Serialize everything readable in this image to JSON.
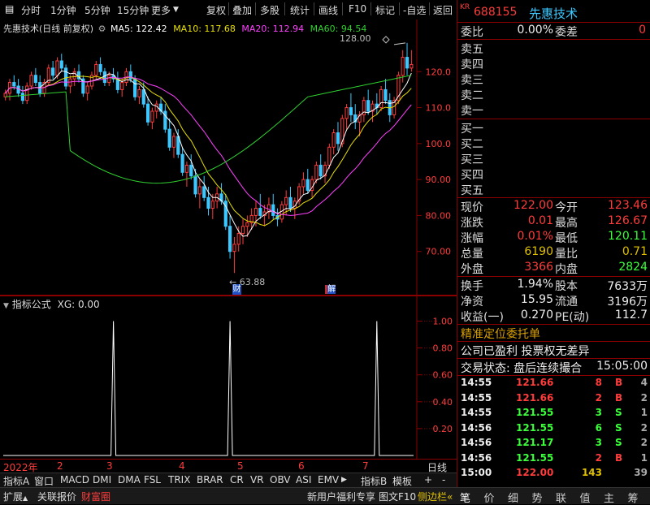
{
  "toolbar": {
    "left_items": [
      "分时",
      "1分钟",
      "5分钟",
      "15分钟",
      "更多"
    ],
    "right_items": [
      "复权",
      "叠加",
      "多股",
      "统计",
      "画线",
      "F10",
      "标记",
      "-自选",
      "返回"
    ]
  },
  "chart_header": {
    "title": "先惠技术(日线 前复权)",
    "ma5": "MA5: 122.42",
    "ma10": "MA10: 117.68",
    "ma20": "MA20: 112.94",
    "ma60": "MA60: 94.54"
  },
  "chart_annotations": {
    "high_label": "128.00",
    "low_label": "63.88",
    "marker_cai": "财",
    "marker_jie": "解"
  },
  "indicator_header": {
    "title": "指标公式",
    "value": "XG: 0.00"
  },
  "time_axis": {
    "year": "2022年",
    "months": [
      "2",
      "3",
      "4",
      "5",
      "6",
      "7"
    ],
    "right_label": "日线"
  },
  "chart_data": [
    {
      "type": "candlestick",
      "title": "先惠技术(日线 前复权)",
      "ylim": [
        60,
        130
      ],
      "y_ticks": [
        "120.0",
        "110.0",
        "100.0",
        "90.00",
        "80.00",
        "70.00"
      ],
      "y_tick_values": [
        120,
        110,
        100,
        90,
        80,
        70
      ],
      "series": [
        {
          "name": "MA5",
          "color": "#ffffff"
        },
        {
          "name": "MA10",
          "color": "#e8e000"
        },
        {
          "name": "MA20",
          "color": "#ff40ff"
        },
        {
          "name": "MA60",
          "color": "#30d030"
        }
      ],
      "candles": [
        [
          113,
          115,
          112,
          114
        ],
        [
          114,
          118,
          112,
          117
        ],
        [
          117,
          119,
          115,
          116
        ],
        [
          116,
          118,
          113,
          114
        ],
        [
          114,
          116,
          111,
          112
        ],
        [
          112,
          117,
          111,
          116
        ],
        [
          116,
          120,
          115,
          119
        ],
        [
          119,
          121,
          116,
          117
        ],
        [
          117,
          119,
          113,
          114
        ],
        [
          114,
          118,
          113,
          117
        ],
        [
          117,
          122,
          116,
          121
        ],
        [
          121,
          123,
          118,
          119
        ],
        [
          119,
          124,
          118,
          123
        ],
        [
          123,
          125,
          120,
          121
        ],
        [
          121,
          122,
          115,
          116
        ],
        [
          116,
          119,
          114,
          118
        ],
        [
          118,
          121,
          116,
          120
        ],
        [
          120,
          122,
          117,
          118
        ],
        [
          118,
          119,
          113,
          114
        ],
        [
          114,
          117,
          112,
          116
        ],
        [
          116,
          120,
          115,
          119
        ],
        [
          119,
          123,
          118,
          122
        ],
        [
          122,
          124,
          119,
          120
        ],
        [
          120,
          121,
          116,
          117
        ],
        [
          117,
          120,
          116,
          119
        ],
        [
          119,
          121,
          117,
          118
        ],
        [
          118,
          120,
          114,
          115
        ],
        [
          115,
          118,
          113,
          117
        ],
        [
          117,
          121,
          116,
          120
        ],
        [
          120,
          122,
          117,
          118
        ],
        [
          118,
          119,
          112,
          113
        ],
        [
          113,
          116,
          111,
          115
        ],
        [
          115,
          117,
          110,
          111
        ],
        [
          111,
          113,
          105,
          106
        ],
        [
          106,
          110,
          104,
          109
        ],
        [
          109,
          112,
          107,
          111
        ],
        [
          111,
          113,
          108,
          109
        ],
        [
          109,
          111,
          103,
          104
        ],
        [
          104,
          107,
          98,
          99
        ],
        [
          99,
          103,
          96,
          102
        ],
        [
          102,
          104,
          96,
          97
        ],
        [
          97,
          99,
          91,
          92
        ],
        [
          92,
          95,
          88,
          94
        ],
        [
          94,
          97,
          90,
          91
        ],
        [
          91,
          93,
          85,
          86
        ],
        [
          86,
          90,
          82,
          88
        ],
        [
          88,
          91,
          84,
          85
        ],
        [
          85,
          88,
          80,
          82
        ],
        [
          82,
          86,
          79,
          84
        ],
        [
          84,
          88,
          82,
          86
        ],
        [
          86,
          89,
          83,
          84
        ],
        [
          84,
          86,
          76,
          77
        ],
        [
          77,
          80,
          68,
          70
        ],
        [
          70,
          74,
          64,
          72
        ],
        [
          72,
          77,
          70,
          75
        ],
        [
          75,
          79,
          72,
          77
        ],
        [
          77,
          80,
          74,
          78
        ],
        [
          78,
          82,
          76,
          80
        ],
        [
          80,
          84,
          77,
          82
        ],
        [
          82,
          86,
          79,
          80
        ],
        [
          80,
          83,
          77,
          81
        ],
        [
          81,
          85,
          79,
          83
        ],
        [
          83,
          86,
          79,
          80
        ],
        [
          80,
          82,
          77,
          79
        ],
        [
          79,
          84,
          78,
          83
        ],
        [
          83,
          87,
          80,
          85
        ],
        [
          85,
          88,
          81,
          82
        ],
        [
          82,
          85,
          79,
          84
        ],
        [
          84,
          89,
          83,
          88
        ],
        [
          88,
          92,
          86,
          90
        ],
        [
          90,
          93,
          86,
          87
        ],
        [
          87,
          91,
          85,
          90
        ],
        [
          90,
          95,
          89,
          94
        ],
        [
          94,
          97,
          90,
          91
        ],
        [
          91,
          95,
          89,
          94
        ],
        [
          94,
          100,
          93,
          99
        ],
        [
          99,
          104,
          97,
          103
        ],
        [
          103,
          106,
          98,
          100
        ],
        [
          100,
          108,
          99,
          107
        ],
        [
          107,
          111,
          104,
          110
        ],
        [
          110,
          114,
          106,
          108
        ],
        [
          108,
          111,
          104,
          106
        ],
        [
          106,
          109,
          102,
          108
        ],
        [
          108,
          113,
          106,
          112
        ],
        [
          112,
          115,
          108,
          109
        ],
        [
          109,
          112,
          106,
          111
        ],
        [
          111,
          114,
          108,
          110
        ],
        [
          110,
          116,
          109,
          115
        ],
        [
          115,
          118,
          111,
          112
        ],
        [
          112,
          114,
          106,
          108
        ],
        [
          108,
          113,
          107,
          112
        ],
        [
          112,
          120,
          111,
          119
        ],
        [
          119,
          126,
          117,
          124
        ],
        [
          124,
          128,
          119,
          121
        ],
        [
          121,
          126,
          120,
          122
        ]
      ]
    },
    {
      "type": "line",
      "title": "指标公式",
      "ylim": [
        0,
        1.1
      ],
      "y_ticks": [
        "1.00",
        "0.80",
        "0.60",
        "0.40",
        "0.20"
      ],
      "y_tick_values": [
        1.0,
        0.8,
        0.6,
        0.4,
        0.2
      ],
      "series": [
        {
          "name": "XG",
          "color": "#ffffff",
          "spikes_at_candle": [
            25,
            52,
            86
          ]
        }
      ]
    }
  ],
  "quote": {
    "prefix": "KR",
    "code": "688155",
    "name": "先惠技术",
    "webi_label": "委比",
    "webi_value": "0.00%",
    "weicha_label": "委差",
    "weicha_value": "0",
    "sell_labels": [
      "卖五",
      "卖四",
      "卖三",
      "卖二",
      "卖一"
    ],
    "buy_labels": [
      "买一",
      "买二",
      "买三",
      "买四",
      "买五"
    ],
    "stats": [
      {
        "l1": "现价",
        "v1": "122.00",
        "c1": "red",
        "l2": "今开",
        "v2": "123.46",
        "c2": "red"
      },
      {
        "l1": "涨跌",
        "v1": "0.01",
        "c1": "red",
        "l2": "最高",
        "v2": "126.67",
        "c2": "red"
      },
      {
        "l1": "涨幅",
        "v1": "0.01%",
        "c1": "red",
        "l2": "最低",
        "v2": "120.11",
        "c2": "green"
      },
      {
        "l1": "总量",
        "v1": "6190",
        "c1": "yellow",
        "l2": "量比",
        "v2": "0.71",
        "c2": "yellow"
      },
      {
        "l1": "外盘",
        "v1": "3366",
        "c1": "red",
        "l2": "内盘",
        "v2": "2824",
        "c2": "green"
      }
    ],
    "stats2": [
      {
        "l1": "换手",
        "v1": "1.94%",
        "l2": "股本",
        "v2": "7633万"
      },
      {
        "l1": "净资",
        "v1": "15.95",
        "l2": "流通",
        "v2": "3196万"
      },
      {
        "l1": "收益(一)",
        "v1": "0.270",
        "l2": "PE(动)",
        "v2": "112.7"
      }
    ],
    "promo": "精准定位委托单",
    "notice": "公司已盈利 投票权无差异",
    "trade_status_label": "交易状态: 盘后连续撮合",
    "trade_status_time": "15:05:00",
    "ticks": [
      {
        "time": "14:55",
        "price": "121.66",
        "vol": "8",
        "dir": "B",
        "n": "4"
      },
      {
        "time": "14:55",
        "price": "121.66",
        "vol": "2",
        "dir": "B",
        "n": "2"
      },
      {
        "time": "14:55",
        "price": "121.55",
        "vol": "3",
        "dir": "S",
        "n": "1"
      },
      {
        "time": "14:56",
        "price": "121.55",
        "vol": "6",
        "dir": "S",
        "n": "2"
      },
      {
        "time": "14:56",
        "price": "121.17",
        "vol": "3",
        "dir": "S",
        "n": "2"
      },
      {
        "time": "14:56",
        "price": "121.55",
        "vol": "2",
        "dir": "B",
        "n": "1"
      },
      {
        "time": "15:00",
        "price": "122.00",
        "vol": "143",
        "dir": "",
        "n": "39"
      }
    ]
  },
  "bottom_tabs": {
    "row1": [
      "指标A",
      "窗口",
      "MACD",
      "DMI",
      "DMA",
      "FSL",
      "TRIX",
      "BRAR",
      "CR",
      "VR",
      "OBV",
      "ASI",
      "EMV"
    ],
    "row1_right": [
      "指标B",
      "模板",
      "+",
      "-"
    ],
    "row2": [
      "扩展",
      "关联报价",
      "财富圈"
    ],
    "row2_right": [
      "新用户福利专享",
      "图文F10",
      "侧边栏"
    ],
    "right_panel_tabs": [
      "笔",
      "价",
      "细",
      "势",
      "联",
      "值",
      "主",
      "筹"
    ]
  },
  "colors": {
    "up": "#ff3c3c",
    "down": "#3cc8ff",
    "frame": "#8a0000",
    "ma5": "#ffffff",
    "ma10": "#e8e000",
    "ma20": "#ff40ff",
    "ma60": "#30d030"
  }
}
